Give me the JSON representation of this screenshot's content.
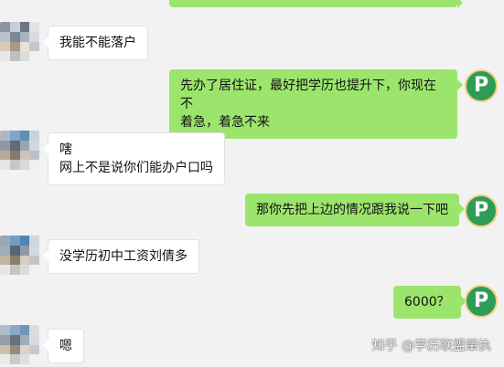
{
  "chat": {
    "messages": [
      {
        "side": "left",
        "text": "我能不能落户"
      },
      {
        "side": "right",
        "text": "先办了居住证，最好把学历也提升下，你现在不\n着急，着急不来"
      },
      {
        "side": "left",
        "text": "嗐\n网上不是说你们能办户口吗"
      },
      {
        "side": "right",
        "text": "那你先把上边的情况跟我说一下吧"
      },
      {
        "side": "left",
        "text": "没学历初中工资刘倩多"
      },
      {
        "side": "right",
        "text": "6000？"
      },
      {
        "side": "left",
        "text": "嗯"
      }
    ],
    "right_avatar_letter": "P"
  },
  "watermark": {
    "text": "知乎 @学历联盟肇执"
  },
  "colors": {
    "background": "#f2f2f2",
    "right_bubble": "#9ce56c",
    "left_bubble": "#ffffff",
    "right_avatar": "#2e9c56"
  }
}
